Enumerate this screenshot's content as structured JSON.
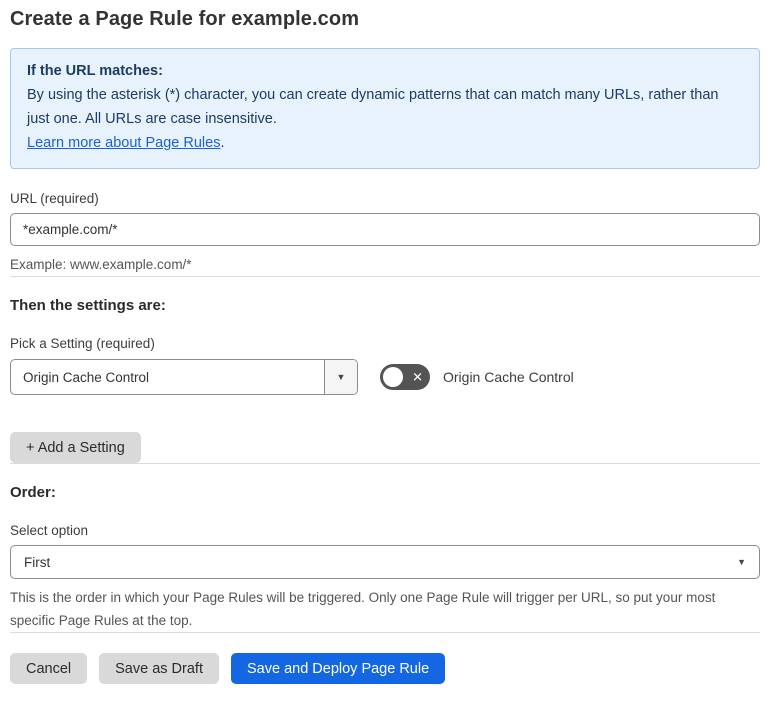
{
  "page": {
    "title": "Create a Page Rule for example.com"
  },
  "info_box": {
    "heading": "If the URL matches:",
    "body": "By using the asterisk (*) character, you can create dynamic patterns that can match many URLs, rather than just one. All URLs are case insensitive.",
    "link_label": "Learn more about Page Rules",
    "link_suffix": "."
  },
  "url_field": {
    "label": "URL (required)",
    "value": "*example.com/*",
    "example": "Example: www.example.com/*"
  },
  "settings_section": {
    "heading": "Then the settings are:",
    "setting_label": "Pick a Setting (required)",
    "setting_value": "Origin Cache Control",
    "toggle_label": "Origin Cache Control",
    "toggle_state": "off",
    "add_setting_label": "+ Add a Setting"
  },
  "order_section": {
    "heading": "Order:",
    "select_label": "Select option",
    "select_value": "First",
    "help_text": "This is the order in which your Page Rules will be triggered. Only one Page Rule will trigger per URL, so put your most specific Page Rules at the top."
  },
  "footer": {
    "cancel_label": "Cancel",
    "save_draft_label": "Save as Draft",
    "save_deploy_label": "Save and Deploy Page Rule"
  },
  "icons": {
    "caret_down": "▼",
    "toggle_off_x": "✕"
  },
  "colors": {
    "info_bg": "#e8f2fc",
    "info_border": "#a5c9ef",
    "info_text": "#1c3c62",
    "link_blue": "#1a62d6",
    "primary_button_blue": "#1467e2",
    "gray_button": "#d9d9d9",
    "toggle_off_gray": "#545454",
    "divider_gray": "#dcdcdc",
    "input_border": "#8c8c8c"
  }
}
